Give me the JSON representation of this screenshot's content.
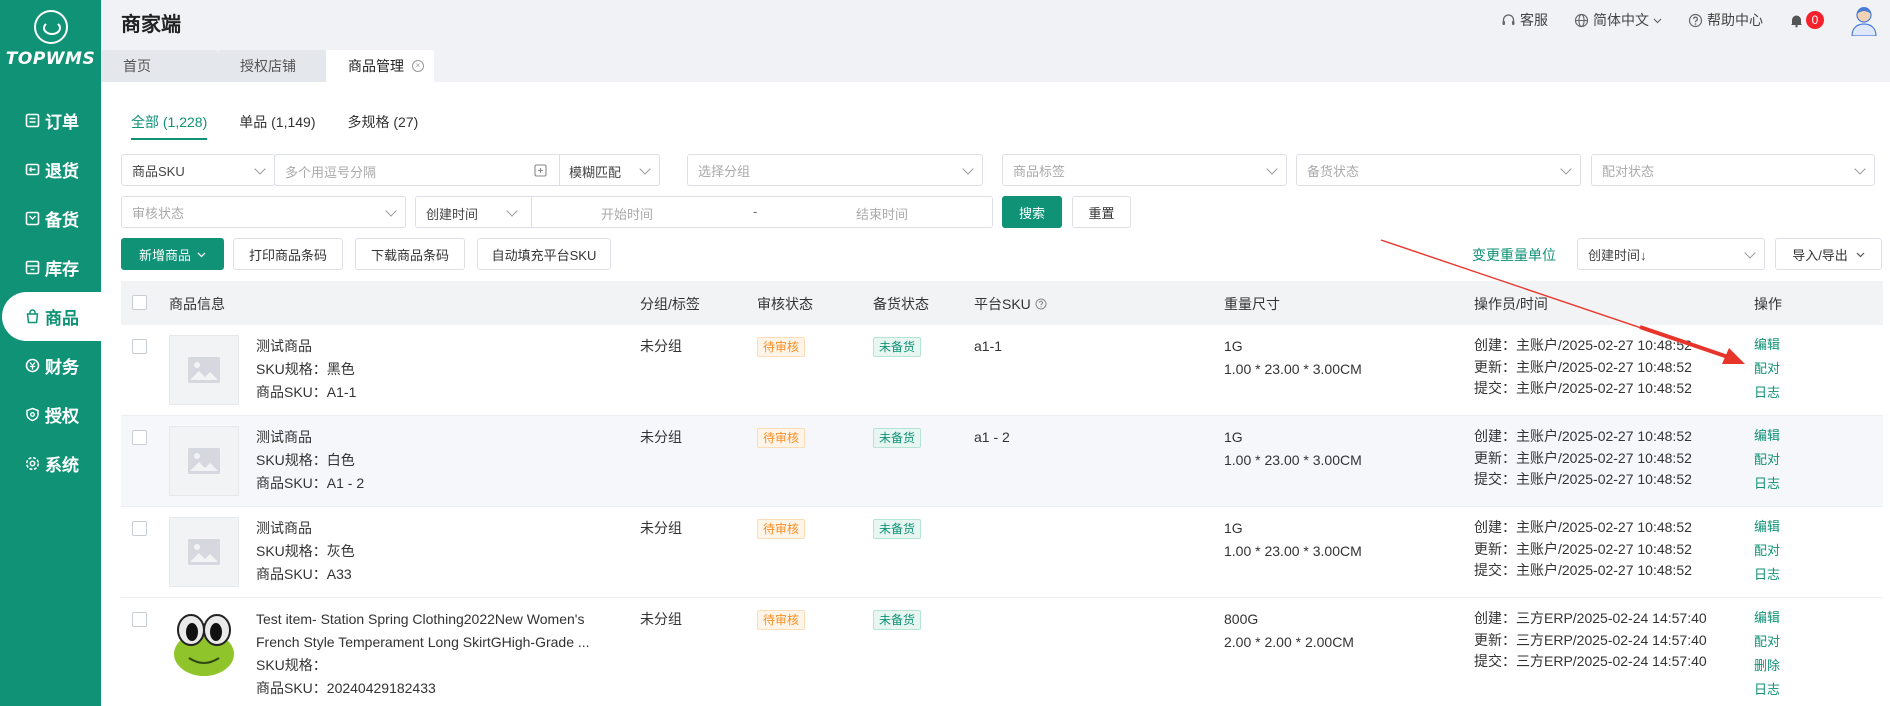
{
  "brand": {
    "name": "TOPWMS",
    "accent": "#0f9276"
  },
  "sidebar": {
    "items": [
      {
        "label": "订单",
        "icon": "order-icon"
      },
      {
        "label": "退货",
        "icon": "return-icon"
      },
      {
        "label": "备货",
        "icon": "stock-icon"
      },
      {
        "label": "库存",
        "icon": "inventory-icon"
      },
      {
        "label": "商品",
        "icon": "goods-icon",
        "active": true
      },
      {
        "label": "财务",
        "icon": "finance-icon"
      },
      {
        "label": "授权",
        "icon": "auth-icon"
      },
      {
        "label": "系统",
        "icon": "settings-icon"
      }
    ]
  },
  "header": {
    "title": "商家端",
    "support": "客服",
    "language": "简体中文",
    "help": "帮助中心",
    "notifications": "0"
  },
  "page_tabs": [
    {
      "label": "首页"
    },
    {
      "label": "授权店铺"
    },
    {
      "label": "商品管理",
      "active": true
    }
  ],
  "filter_tabs": [
    {
      "label": "全部 (1,228)",
      "active": true
    },
    {
      "label": "单品 (1,149)"
    },
    {
      "label": "多规格 (27)"
    }
  ],
  "filters": {
    "sku_type": "商品SKU",
    "sku_input_placeholder": "多个用逗号分隔",
    "match_mode": "模糊匹配",
    "group_placeholder": "选择分组",
    "tag_placeholder": "商品标签",
    "stock_status_placeholder": "备货状态",
    "pair_status_placeholder": "配对状态",
    "review_status_placeholder": "审核状态",
    "time_type": "创建时间",
    "start_placeholder": "开始时间",
    "range_sep": "-",
    "end_placeholder": "结束时间",
    "search_label": "搜索",
    "reset_label": "重置"
  },
  "toolbar": {
    "add_label": "新增商品",
    "print_label": "打印商品条码",
    "download_label": "下载商品条码",
    "autofill_label": "自动填充平台SKU",
    "weight_unit_label": "变更重量单位",
    "sort_value": "创建时间↓",
    "import_export_label": "导入/导出"
  },
  "table": {
    "columns": {
      "info": "商品信息",
      "group": "分组/标签",
      "review": "审核状态",
      "stock": "备货状态",
      "platform_sku": "平台SKU",
      "weight": "重量尺寸",
      "operator": "操作员/时间",
      "actions": "操作"
    },
    "rows": [
      {
        "name": "测试商品",
        "spec": "SKU规格：黑色",
        "sku": "商品SKU：A1-1",
        "group": "未分组",
        "review": "待审核",
        "stock": "未备货",
        "platform_sku": "a1-1",
        "weight": "1G",
        "dims": "1.00 * 23.00 * 3.00CM",
        "created": "创建：主账户/2025-02-27 10:48:52",
        "updated": "更新：主账户/2025-02-27 10:48:52",
        "submitted": "提交：主账户/2025-02-27 10:48:52",
        "actions": [
          "编辑",
          "配对",
          "日志"
        ]
      },
      {
        "name": "测试商品",
        "spec": "SKU规格：白色",
        "sku": "商品SKU：A1 - 2",
        "group": "未分组",
        "review": "待审核",
        "stock": "未备货",
        "platform_sku": "a1 - 2",
        "weight": "1G",
        "dims": "1.00 * 23.00 * 3.00CM",
        "created": "创建：主账户/2025-02-27 10:48:52",
        "updated": "更新：主账户/2025-02-27 10:48:52",
        "submitted": "提交：主账户/2025-02-27 10:48:52",
        "actions": [
          "编辑",
          "配对",
          "日志"
        ]
      },
      {
        "name": "测试商品",
        "spec": "SKU规格：灰色",
        "sku": "商品SKU：A33",
        "group": "未分组",
        "review": "待审核",
        "stock": "未备货",
        "platform_sku": "",
        "weight": "1G",
        "dims": "1.00 * 23.00 * 3.00CM",
        "created": "创建：主账户/2025-02-27 10:48:52",
        "updated": "更新：主账户/2025-02-27 10:48:52",
        "submitted": "提交：主账户/2025-02-27 10:48:52",
        "actions": [
          "编辑",
          "配对",
          "日志"
        ]
      },
      {
        "name": "Test item- Station Spring Clothing2022New Women's",
        "name2": "French Style Temperament Long SkirtGHigh-Grade ...",
        "spec": "SKU规格：",
        "sku": "商品SKU：20240429182433",
        "group": "未分组",
        "review": "待审核",
        "stock": "未备货",
        "platform_sku": "",
        "weight": "800G",
        "dims": "2.00 * 2.00 * 2.00CM",
        "created": "创建：三方ERP/2025-02-24 14:57:40",
        "updated": "更新：三方ERP/2025-02-24 14:57:40",
        "submitted": "提交：三方ERP/2025-02-24 14:57:40",
        "actions": [
          "编辑",
          "配对",
          "删除",
          "日志"
        ]
      }
    ]
  }
}
